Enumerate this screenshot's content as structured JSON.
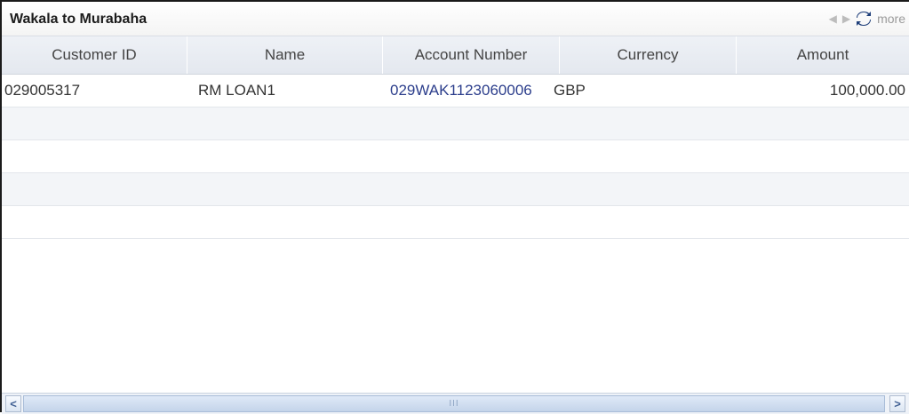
{
  "panel": {
    "title": "Wakala to Murabaha",
    "more_label": "more",
    "prev_icon": "left-arrow-icon",
    "next_icon": "right-arrow-icon",
    "refresh_icon": "refresh-icon"
  },
  "table": {
    "columns": [
      "Customer ID",
      "Name",
      "Account Number",
      "Currency",
      "Amount"
    ],
    "rows": [
      {
        "customer_id": "029005317",
        "name": "RM LOAN1",
        "account_number": "029WAK1123060006",
        "currency": "GBP",
        "amount": "100,000.00"
      }
    ]
  },
  "scrollbar": {
    "left_glyph": "<",
    "right_glyph": ">",
    "grip": "III"
  },
  "colors": {
    "link": "#2c3e8c",
    "header_bg": "#e4e8ef",
    "refresh_icon": "#1f3f7a"
  }
}
